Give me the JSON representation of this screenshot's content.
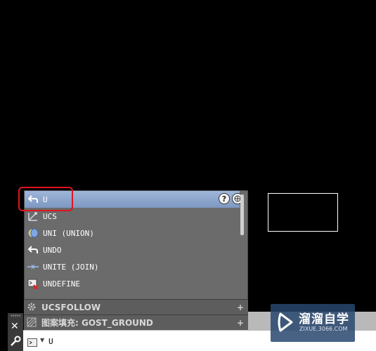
{
  "autocomplete": {
    "items": [
      {
        "label": "U",
        "icon": "undo-arrow-icon",
        "selected": true
      },
      {
        "label": "UCS",
        "icon": "ucs-icon"
      },
      {
        "label": "UNI (UNION)",
        "icon": "union-icon"
      },
      {
        "label": "UNDO",
        "icon": "undo-arrow-icon"
      },
      {
        "label": "UNITE (JOIN)",
        "icon": "join-icon"
      },
      {
        "label": "UNDEFINE",
        "icon": "undefine-icon"
      }
    ],
    "help_button": "?",
    "web_button": "globe-icon"
  },
  "history": [
    {
      "label": "UCSFOLLOW",
      "icon": "gear-icon",
      "action": "+"
    },
    {
      "label": "图案填充: GOST_GROUND",
      "icon": "hatch-icon",
      "action": "+"
    }
  ],
  "command_line": {
    "value": "U",
    "close_label": "✕"
  },
  "watermark": {
    "title": "溜溜自学",
    "subtitle": "ZIXUE.3066.COM"
  },
  "colors": {
    "highlight": "#e0141e",
    "selected_row": "#8aa3ca",
    "popup_bg": "#6b6b6b"
  }
}
